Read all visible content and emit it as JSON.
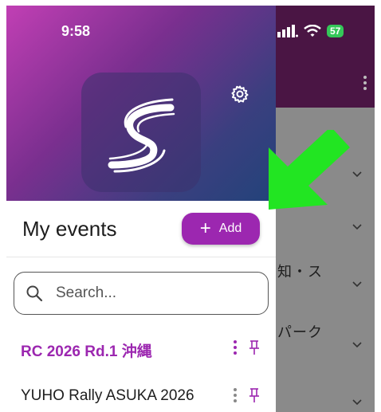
{
  "status_bar": {
    "time": "9:58",
    "battery": "57"
  },
  "background_app": {
    "row_texts": [
      "知・ス",
      "パーク"
    ]
  },
  "drawer": {
    "section_title": "My events",
    "add_button_label": "Add",
    "search": {
      "placeholder": "Search...",
      "value": ""
    },
    "events": [
      {
        "label": "RC 2026 Rd.1 沖縄",
        "active": true
      },
      {
        "label": "YUHO Rally ASUKA 2026",
        "active": false
      }
    ]
  },
  "colors": {
    "accent": "#9c27b0",
    "arrow": "#22e522",
    "header_dark": "#4a1544"
  },
  "icons": [
    "settings-gear-icon",
    "search-icon",
    "more-vert-icon",
    "pin-icon",
    "chevron-down-icon",
    "wifi-icon",
    "signal-icon",
    "battery-icon",
    "app-logo-icon"
  ]
}
